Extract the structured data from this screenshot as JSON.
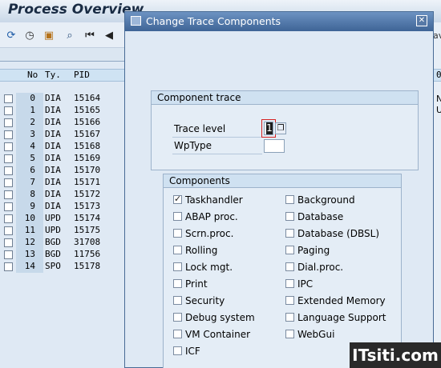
{
  "window": {
    "title": "Process Overview",
    "right_fragment": "av"
  },
  "toolbar": {
    "icons": [
      "refresh-icon",
      "clock-icon",
      "save-layout-icon",
      "find-icon",
      "first-page-icon",
      "previous-page-icon"
    ]
  },
  "table": {
    "headers": {
      "no": "No",
      "type": "Ty.",
      "pid": "PID"
    },
    "rows": [
      {
        "no": "0",
        "type": "DIA",
        "pid": "15164"
      },
      {
        "no": "1",
        "type": "DIA",
        "pid": "15165"
      },
      {
        "no": "2",
        "type": "DIA",
        "pid": "15166"
      },
      {
        "no": "3",
        "type": "DIA",
        "pid": "15167"
      },
      {
        "no": "4",
        "type": "DIA",
        "pid": "15168"
      },
      {
        "no": "5",
        "type": "DIA",
        "pid": "15169"
      },
      {
        "no": "6",
        "type": "DIA",
        "pid": "15170"
      },
      {
        "no": "7",
        "type": "DIA",
        "pid": "15171"
      },
      {
        "no": "8",
        "type": "DIA",
        "pid": "15172"
      },
      {
        "no": "9",
        "type": "DIA",
        "pid": "15173"
      },
      {
        "no": "10",
        "type": "UPD",
        "pid": "15174"
      },
      {
        "no": "11",
        "type": "UPD",
        "pid": "15175"
      },
      {
        "no": "12",
        "type": "BGD",
        "pid": "31708"
      },
      {
        "no": "13",
        "type": "BGD",
        "pid": "11756"
      },
      {
        "no": "14",
        "type": "SPO",
        "pid": "15178"
      }
    ],
    "right_header_fragment": "0",
    "right_cells": [
      "N",
      "U"
    ]
  },
  "dialog": {
    "title": "Change Trace Components",
    "component_trace": {
      "header": "Component trace",
      "trace_level_label": "Trace level",
      "trace_level_value": "1",
      "wptype_label": "WpType",
      "wptype_value": ""
    },
    "components": {
      "header": "Components",
      "left": [
        {
          "label": "Taskhandler",
          "checked": true
        },
        {
          "label": "ABAP proc.",
          "checked": false
        },
        {
          "label": "Scrn.proc.",
          "checked": false
        },
        {
          "label": "Rolling",
          "checked": false
        },
        {
          "label": "Lock mgt.",
          "checked": false
        },
        {
          "label": "Print",
          "checked": false
        },
        {
          "label": "Security",
          "checked": false
        },
        {
          "label": "Debug system",
          "checked": false
        },
        {
          "label": "VM Container",
          "checked": false
        },
        {
          "label": "ICF",
          "checked": false
        }
      ],
      "right": [
        {
          "label": "Background",
          "checked": false
        },
        {
          "label": "Database",
          "checked": false
        },
        {
          "label": "Database (DBSL)",
          "checked": false
        },
        {
          "label": "Paging",
          "checked": false
        },
        {
          "label": "Dial.proc.",
          "checked": false
        },
        {
          "label": "IPC",
          "checked": false
        },
        {
          "label": "Extended Memory",
          "checked": false
        },
        {
          "label": "Language Support",
          "checked": false
        },
        {
          "label": "WebGui",
          "checked": false
        }
      ]
    }
  },
  "watermark": "ITsiti.com",
  "colors": {
    "dialog_title": "#3e6496",
    "dialog_bg": "#dfe9f4",
    "header_bg": "#cfe1f1",
    "focus": "#d62222"
  }
}
